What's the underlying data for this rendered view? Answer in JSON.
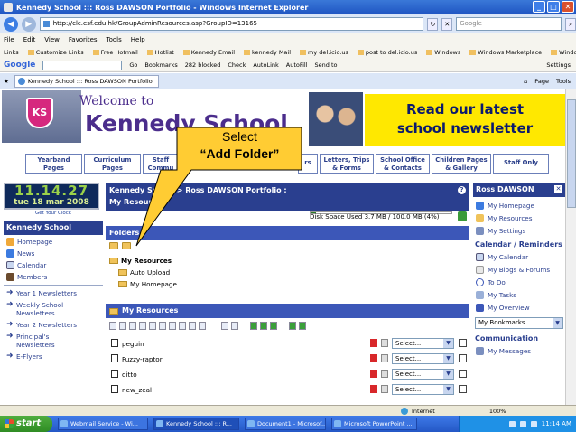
{
  "window": {
    "title": "Kennedy School ::: Ross DAWSON Portfolio - Windows Internet Explorer",
    "minimize": "_",
    "maximize": "□",
    "close": "✕"
  },
  "addressbar": {
    "url": "http://clc.esf.edu.hk/GroupAdminResources.asp?GroupID=13165",
    "search_placeholder": "Google",
    "back_icon": "back-arrow-icon",
    "forward_icon": "forward-arrow-icon"
  },
  "menu": [
    "File",
    "Edit",
    "View",
    "Favorites",
    "Tools",
    "Help"
  ],
  "links_bar": {
    "label": "Links",
    "items": [
      "Customize Links",
      "Free Hotmail",
      "Hotlist",
      "Kennedy Email",
      "kennedy Mail",
      "my del.icio.us",
      "post to del.icio.us",
      "Windows",
      "Windows Marketplace",
      "Windows Media"
    ]
  },
  "google_bar": {
    "logo": "Google",
    "go": "Go",
    "items": [
      "Bookmarks",
      "282 blocked",
      "Check",
      "AutoLink",
      "AutoFill",
      "Send to"
    ],
    "settings": "Settings"
  },
  "tab": {
    "label": "Kennedy School ::: Ross DAWSON Portfolio",
    "tools": [
      "Page",
      "Tools"
    ]
  },
  "banner": {
    "welcome": "Welcome to",
    "school_name": "Kennedy School",
    "crest_letters": "KS",
    "newsletter_line1": "Read our latest",
    "newsletter_line2": "school newsletter",
    "accent": "#4b2d8c",
    "newsletter_bg": "#ffe800"
  },
  "nav": {
    "yearband": [
      "Yearband",
      "Pages"
    ],
    "curriculum": [
      "Curriculum",
      "Pages"
    ],
    "staff": [
      "Staff",
      "Commu"
    ],
    "parents": "rs",
    "letters": [
      "Letters, Trips",
      "& Forms"
    ],
    "office": [
      "School Office",
      "& Contacts"
    ],
    "children": [
      "Children Pages",
      "& Gallery"
    ],
    "staff_only": "Staff Only"
  },
  "clock": {
    "time": "11.14.27",
    "date": "tue 18 mar 2008",
    "get_clock": "Get Your Clock"
  },
  "left": {
    "header": "Kennedy School",
    "items": [
      {
        "label": "Homepage",
        "icon": "homepage-icon"
      },
      {
        "label": "News",
        "icon": "news-icon"
      },
      {
        "label": "Calendar",
        "icon": "calendar-icon"
      },
      {
        "label": "Members",
        "icon": "members-icon"
      }
    ],
    "newsletters": [
      {
        "line1": "Year 1 Newsletters",
        "line2": ""
      },
      {
        "line1": "Weekly School",
        "line2": "Newsletters"
      },
      {
        "line1": "Year 2 Newsletters",
        "line2": ""
      },
      {
        "line1": "Principal's",
        "line2": "Newsletters"
      },
      {
        "line1": "E-Flyers",
        "line2": ""
      }
    ]
  },
  "main": {
    "breadcrumb_line1": "Kennedy School > Ross DAWSON Portfolio :",
    "breadcrumb_line2": "My Resources",
    "help": "?",
    "disk_usage": "Disk Space Used 3.7 MB  /  100.0 MB (4%)",
    "disk_fraction": 0.04,
    "folders_header": "Folders",
    "tree": {
      "root": "My Resources",
      "children": [
        "Auto Upload",
        "My Homepage"
      ]
    },
    "resources_header": "My Resources",
    "rows": [
      {
        "name": "peguin",
        "select": "Select..."
      },
      {
        "name": "Fuzzy-raptor",
        "select": "Select..."
      },
      {
        "name": "ditto",
        "select": "Select..."
      },
      {
        "name": "new_zeal",
        "select": "Select..."
      }
    ]
  },
  "right": {
    "header": "Ross DAWSON",
    "close": "✕",
    "items": [
      {
        "label": "My Homepage",
        "icon": "homepage-icon"
      },
      {
        "label": "My Resources",
        "icon": "resources-icon"
      },
      {
        "label": "My Settings",
        "icon": "settings-icon"
      }
    ],
    "calendar_header": "Calendar / Reminders",
    "calendar_items": [
      {
        "label": "My Calendar",
        "icon": "calendar-icon"
      },
      {
        "label": "My Blogs & Forums",
        "icon": "blog-icon"
      },
      {
        "label": "To Do",
        "icon": "todo-icon"
      },
      {
        "label": "My Tasks",
        "icon": "tasks-icon"
      },
      {
        "label": "My Overview",
        "icon": "overview-icon"
      }
    ],
    "bookmarks_select": "My Bookmarks...",
    "communication_header": "Communication",
    "comm_items": [
      {
        "label": "My Messages",
        "icon": "messages-icon"
      }
    ]
  },
  "callout": {
    "line1": "Select",
    "line2": "“Add Folder”",
    "fill": "#ffcc33"
  },
  "status": {
    "zone": "Internet",
    "zoom": "100%"
  },
  "taskbar": {
    "start": "start",
    "tasks": [
      "Webmail Service - Wi...",
      "Kennedy School ::: R...",
      "Document1 - Microsof...",
      "Microsoft PowerPoint ..."
    ],
    "time": "11:14 AM"
  }
}
